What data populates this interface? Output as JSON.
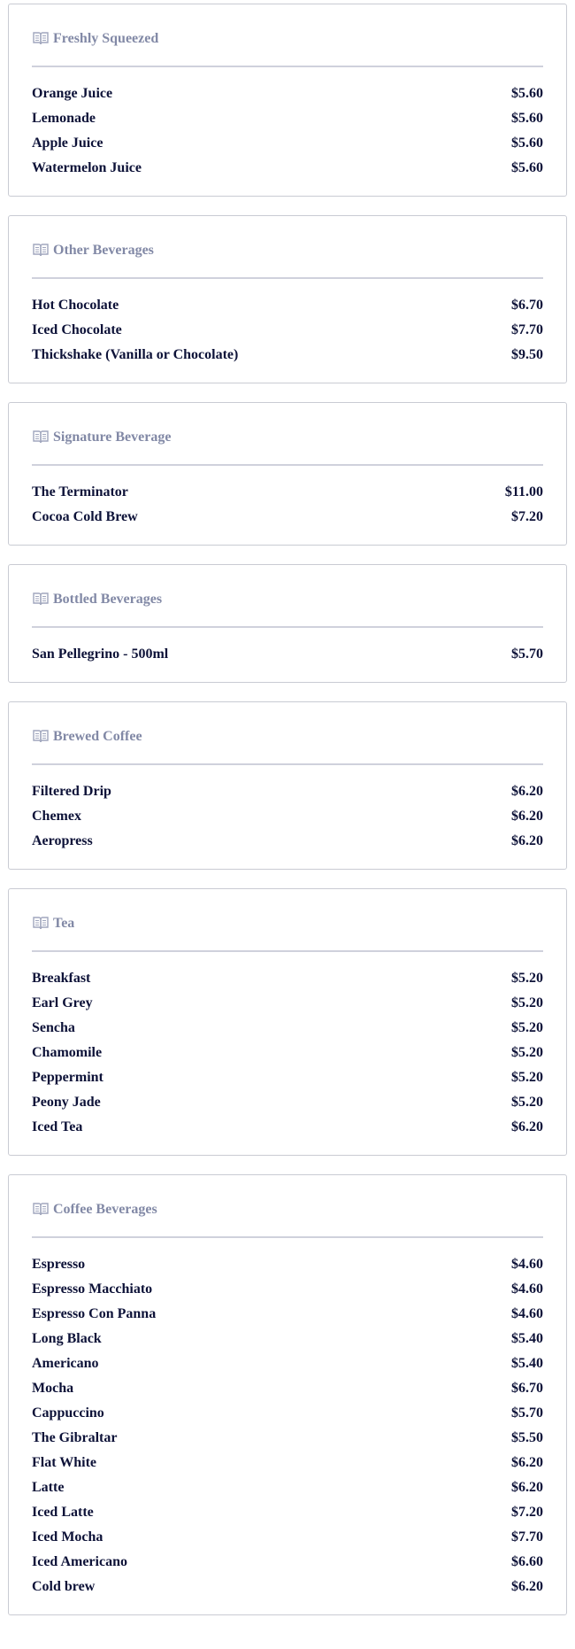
{
  "sections": [
    {
      "title": "Freshly Squeezed",
      "icon": "menu-book-icon",
      "items": [
        {
          "name": "Orange Juice",
          "price": "$5.60"
        },
        {
          "name": "Lemonade",
          "price": "$5.60"
        },
        {
          "name": "Apple Juice",
          "price": "$5.60"
        },
        {
          "name": "Watermelon Juice",
          "price": "$5.60"
        }
      ]
    },
    {
      "title": "Other Beverages",
      "icon": "menu-book-icon",
      "items": [
        {
          "name": "Hot Chocolate",
          "price": "$6.70"
        },
        {
          "name": "Iced Chocolate",
          "price": "$7.70"
        },
        {
          "name": "Thickshake (Vanilla or Chocolate)",
          "price": "$9.50"
        }
      ]
    },
    {
      "title": "Signature Beverage",
      "icon": "menu-book-icon",
      "items": [
        {
          "name": "The Terminator",
          "price": "$11.00"
        },
        {
          "name": "Cocoa Cold Brew",
          "price": "$7.20"
        }
      ]
    },
    {
      "title": "Bottled Beverages",
      "icon": "menu-book-icon",
      "items": [
        {
          "name": "San Pellegrino - 500ml",
          "price": "$5.70"
        }
      ]
    },
    {
      "title": "Brewed Coffee",
      "icon": "menu-book-icon",
      "items": [
        {
          "name": "Filtered Drip",
          "price": "$6.20"
        },
        {
          "name": "Chemex",
          "price": "$6.20"
        },
        {
          "name": "Aeropress",
          "price": "$6.20"
        }
      ]
    },
    {
      "title": "Tea",
      "icon": "menu-book-icon",
      "items": [
        {
          "name": "Breakfast",
          "price": "$5.20"
        },
        {
          "name": "Earl Grey",
          "price": "$5.20"
        },
        {
          "name": "Sencha",
          "price": "$5.20"
        },
        {
          "name": "Chamomile",
          "price": "$5.20"
        },
        {
          "name": "Peppermint",
          "price": "$5.20"
        },
        {
          "name": "Peony Jade",
          "price": "$5.20"
        },
        {
          "name": "Iced Tea",
          "price": "$6.20"
        }
      ]
    },
    {
      "title": "Coffee Beverages",
      "icon": "menu-book-icon",
      "items": [
        {
          "name": "Espresso",
          "price": "$4.60"
        },
        {
          "name": "Espresso Macchiato",
          "price": "$4.60"
        },
        {
          "name": "Espresso Con Panna",
          "price": "$4.60"
        },
        {
          "name": "Long Black",
          "price": "$5.40"
        },
        {
          "name": "Americano",
          "price": "$5.40"
        },
        {
          "name": "Mocha",
          "price": "$6.70"
        },
        {
          "name": "Cappuccino",
          "price": "$5.70"
        },
        {
          "name": "The Gibraltar",
          "price": "$5.50"
        },
        {
          "name": "Flat White",
          "price": "$6.20"
        },
        {
          "name": "Latte",
          "price": "$6.20"
        },
        {
          "name": "Iced Latte",
          "price": "$7.20"
        },
        {
          "name": "Iced Mocha",
          "price": "$7.70"
        },
        {
          "name": "Iced Americano",
          "price": "$6.60"
        },
        {
          "name": "Cold brew",
          "price": "$6.20"
        }
      ]
    }
  ],
  "colors": {
    "heading": "#8289a6",
    "item_text": "#0d1238",
    "border": "#c9cbd3",
    "divider": "#cfd1dc",
    "background": "#ffffff"
  }
}
